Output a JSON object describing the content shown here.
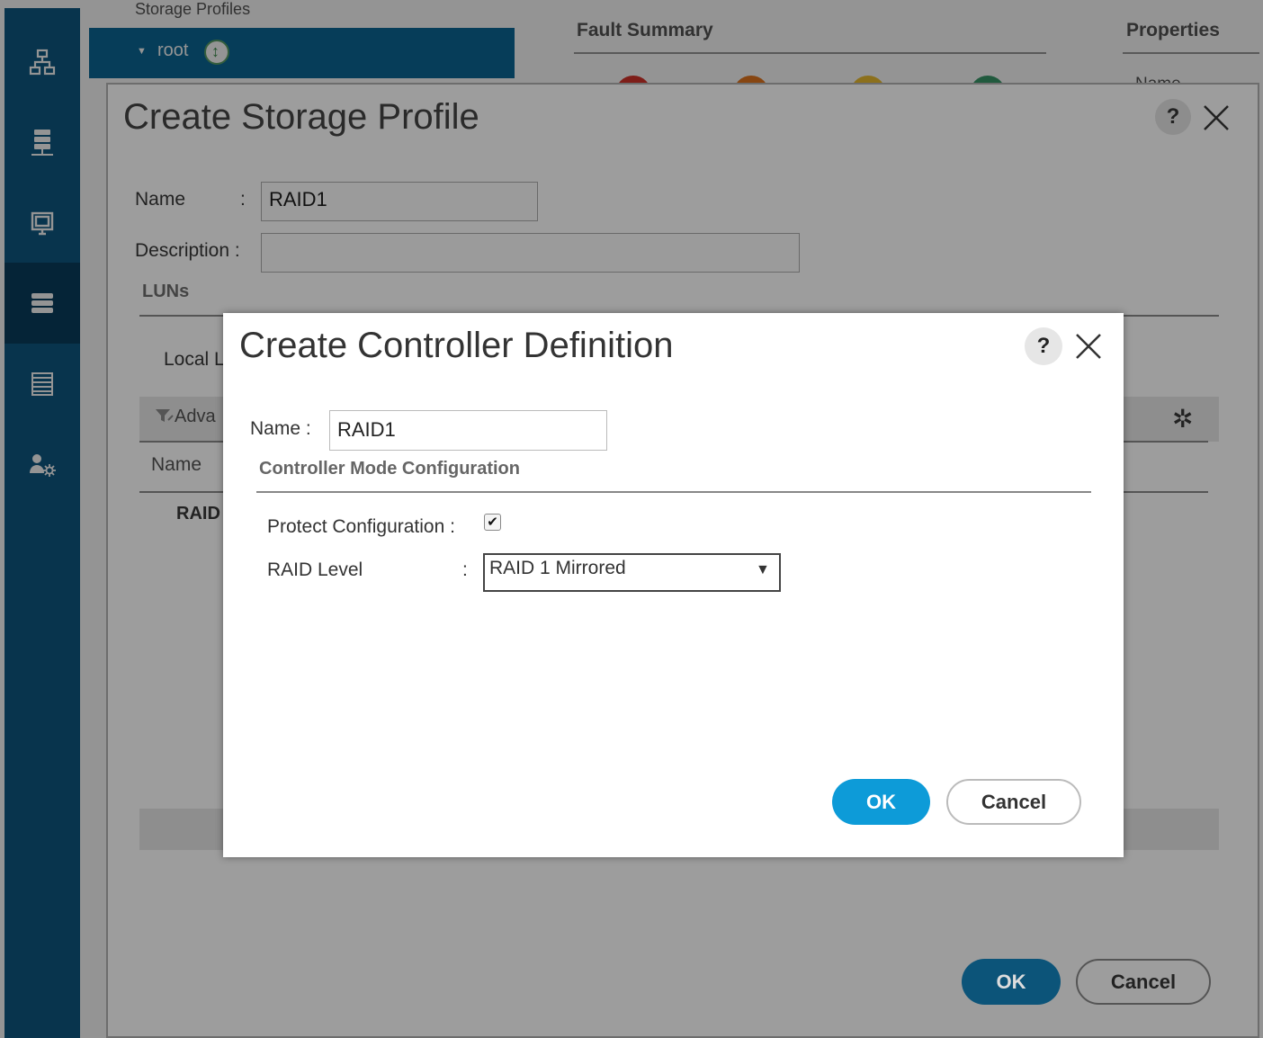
{
  "background": {
    "tree_header": "Storage Profiles",
    "tree_root": "root",
    "fault_summary": "Fault Summary",
    "properties": "Properties",
    "properties_field": "Name"
  },
  "storage_profile_dialog": {
    "title": "Create Storage Profile",
    "help": "?",
    "close": "✕",
    "name_label": "Name",
    "name_colon": ":",
    "name_value": "RAID1",
    "description_label": "Description :",
    "description_value": "",
    "luns_section": "LUNs",
    "local_tab": "Local L",
    "advanced_filter": "Adva",
    "column_name": "Name",
    "row_raid": "RAID",
    "ok_label": "OK",
    "cancel_label": "Cancel"
  },
  "controller_dialog": {
    "title": "Create Controller Definition",
    "help": "?",
    "close": "✕",
    "name_label": "Name :",
    "name_value": "RAID1",
    "section_title": "Controller Mode Configuration",
    "protect_label": "Protect Configuration :",
    "protect_checked": true,
    "raid_label": "RAID Level",
    "raid_colon": ":",
    "raid_value": "RAID 1 Mirrored",
    "ok_label": "OK",
    "cancel_label": "Cancel"
  },
  "nav": {
    "items": [
      {
        "icon": "network-icon"
      },
      {
        "icon": "servers-icon"
      },
      {
        "icon": "monitor-icon"
      },
      {
        "icon": "storage-icon",
        "active": true
      },
      {
        "icon": "list-icon"
      },
      {
        "icon": "admin-icon"
      }
    ]
  },
  "colors": {
    "nav_bg": "#0f5a85",
    "primary_button": "#0d9bd8",
    "fault_critical": "#d9352b",
    "fault_major": "#e8791f",
    "fault_minor": "#f2c231",
    "fault_info": "#3a9b6c"
  }
}
